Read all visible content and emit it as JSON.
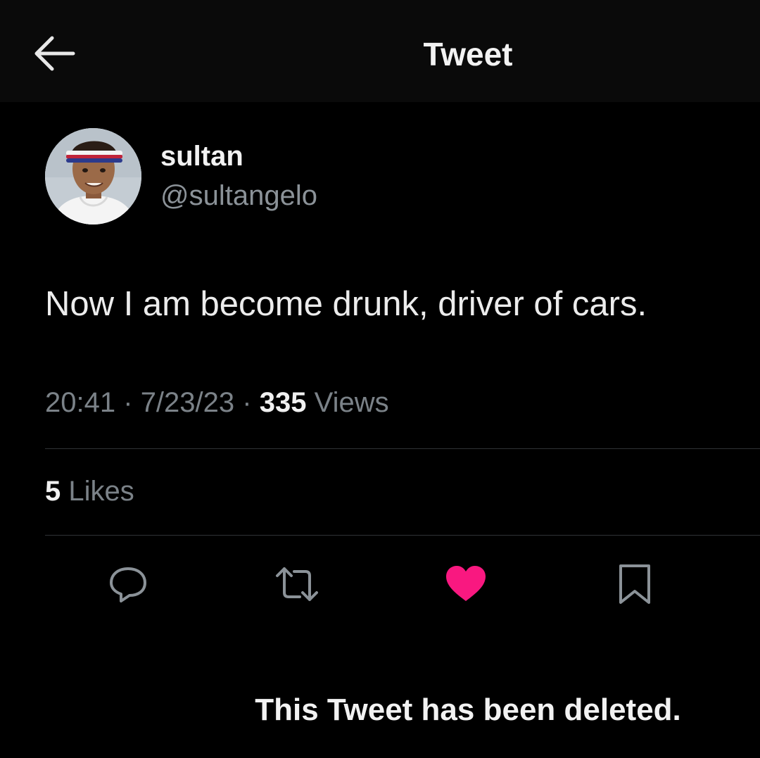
{
  "header": {
    "title": "Tweet",
    "back_icon": "arrow-left-icon"
  },
  "author": {
    "display_name": "sultan",
    "handle": "@sultangelo"
  },
  "tweet": {
    "text": "Now I am become drunk, driver of cars.",
    "time": "20:41",
    "separator": "·",
    "date": "7/23/23",
    "views_count": "335",
    "views_label": "Views"
  },
  "stats": {
    "likes_count": "5",
    "likes_label": "Likes"
  },
  "actions": [
    {
      "icon": "reply-icon"
    },
    {
      "icon": "retweet-icon"
    },
    {
      "icon": "heart-icon",
      "active": true,
      "color": "#f91880"
    },
    {
      "icon": "bookmark-icon"
    }
  ],
  "footer": {
    "note": "This Tweet has been deleted."
  },
  "colors": {
    "background": "#000000",
    "header_background": "#0a0a0a",
    "text_primary": "#e7e9ea",
    "text_secondary": "#7b8288",
    "like_active": "#f91880",
    "divider": "#2f3336"
  }
}
